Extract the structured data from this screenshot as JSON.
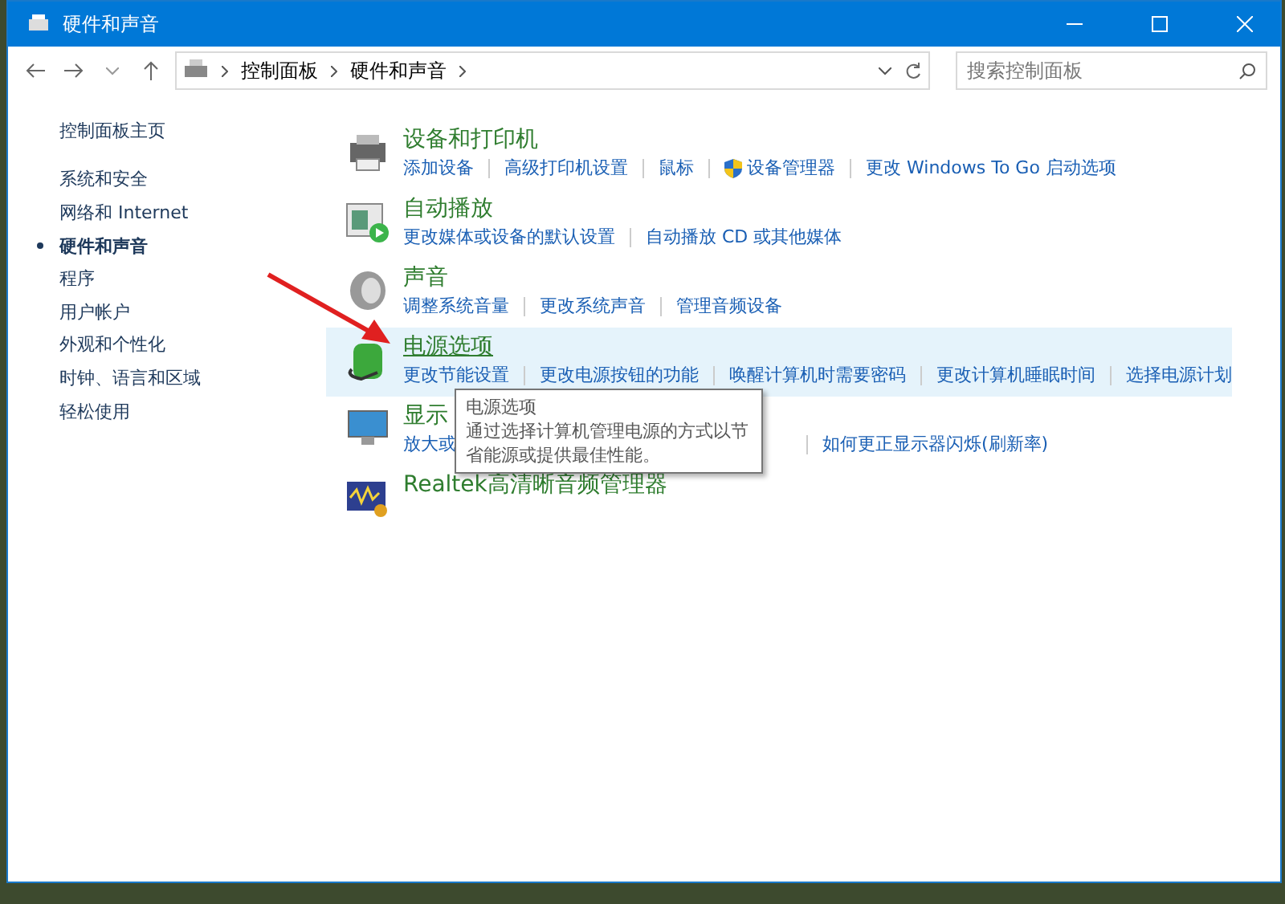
{
  "window": {
    "title": "硬件和声音"
  },
  "address_bar": {
    "breadcrumbs": [
      "控制面板",
      "硬件和声音"
    ]
  },
  "search": {
    "placeholder": "搜索控制面板"
  },
  "sidebar": {
    "home": "控制面板主页",
    "items": [
      {
        "label": "系统和安全",
        "selected": false
      },
      {
        "label": "网络和 Internet",
        "selected": false
      },
      {
        "label": "硬件和声音",
        "selected": true
      },
      {
        "label": "程序",
        "selected": false
      },
      {
        "label": "用户帐户",
        "selected": false
      },
      {
        "label": "外观和个性化",
        "selected": false
      },
      {
        "label": "时钟、语言和区域",
        "selected": false
      },
      {
        "label": "轻松使用",
        "selected": false
      }
    ]
  },
  "categories": [
    {
      "kind": "printer",
      "title": "设备和打印机",
      "highlighted": false,
      "links": [
        {
          "label": "添加设备"
        },
        {
          "label": "高级打印机设置"
        },
        {
          "label": "鼠标"
        },
        {
          "label": "设备管理器",
          "shield": true
        },
        {
          "label": "更改 Windows To Go 启动选项"
        }
      ]
    },
    {
      "kind": "autoplay",
      "title": "自动播放",
      "highlighted": false,
      "links": [
        {
          "label": "更改媒体或设备的默认设置"
        },
        {
          "label": "自动播放 CD 或其他媒体"
        }
      ]
    },
    {
      "kind": "sound",
      "title": "声音",
      "highlighted": false,
      "links": [
        {
          "label": "调整系统音量"
        },
        {
          "label": "更改系统声音"
        },
        {
          "label": "管理音频设备"
        }
      ]
    },
    {
      "kind": "power",
      "title": "电源选项",
      "highlighted": true,
      "links": [
        {
          "label": "更改节能设置"
        },
        {
          "label": "更改电源按钮的功能"
        },
        {
          "label": "唤醒计算机时需要密码"
        },
        {
          "label": "更改计算机睡眠时间"
        },
        {
          "label": "选择电源计划"
        }
      ]
    },
    {
      "kind": "display",
      "title": "显示",
      "highlighted": false,
      "links": [
        {
          "label": "放大或"
        },
        {
          "label": "如何更正显示器闪烁(刷新率)"
        }
      ]
    },
    {
      "kind": "audio",
      "title": "Realtek高清晰音频管理器",
      "highlighted": false
    }
  ],
  "tooltip": {
    "title": "电源选项",
    "text": "通过选择计算机管理电源的方式以节省能源或提供最佳性能。"
  }
}
